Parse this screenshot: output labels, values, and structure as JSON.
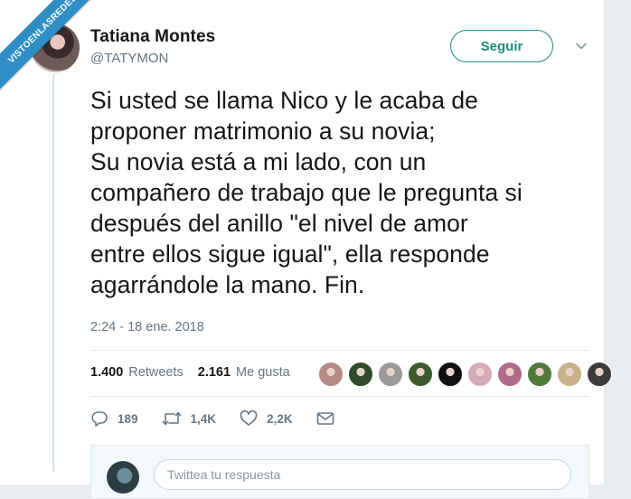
{
  "watermark": "VISTOENLASREDES",
  "user": {
    "name": "Tatiana Montes",
    "handle": "@TATYMON"
  },
  "follow_label": "Seguir",
  "tweet": {
    "lines": [
      "Si usted se llama Nico y le acaba de",
      "proponer matrimonio a su novia;",
      "Su novia está a mi lado, con un",
      "compañero de trabajo que le pregunta si",
      "después del anillo \"el nivel de amor",
      "entre ellos sigue igual\", ella responde",
      "agarrándole la mano. Fin."
    ],
    "timestamp": "2:24 - 18 ene. 2018"
  },
  "stats": {
    "retweets_count": "1.400",
    "retweets_label": "Retweets",
    "likes_count": "2.161",
    "likes_label": "Me gusta"
  },
  "likers": [
    "#b58a84",
    "#2f4a2a",
    "#9a9a9a",
    "#3d5a2c",
    "#111111",
    "#d8a9b8",
    "#b06a8a",
    "#4f7a3a",
    "#c9b28a",
    "#3b3b3b"
  ],
  "actions": {
    "reply_count": "189",
    "retweet_count": "1,4K",
    "like_count": "2,2K"
  },
  "colors": {
    "accent": "#1e8f80",
    "muted": "#657786",
    "thread_line": "#cfe7e2",
    "watermark_bg": "#2f8ec6"
  },
  "reply": {
    "placeholder": "Twittea tu respuesta"
  }
}
